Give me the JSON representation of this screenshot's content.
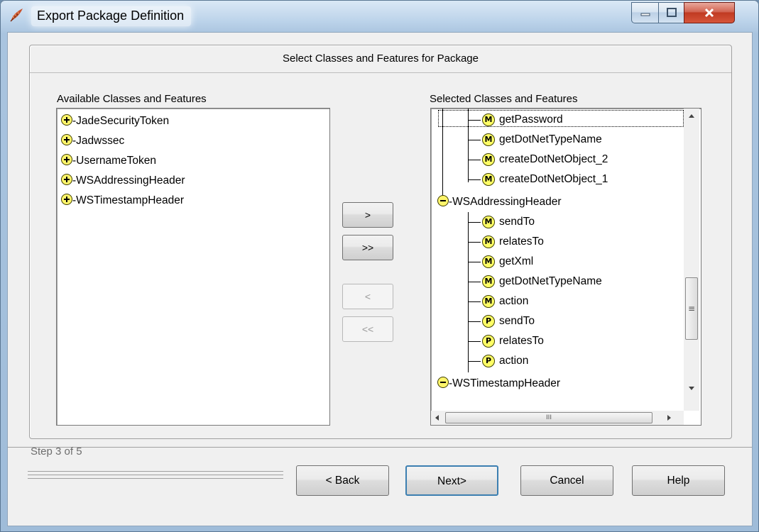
{
  "window": {
    "title": "Export Package Definition"
  },
  "group_header": "Select Classes and Features for Package",
  "available": {
    "label": "Available Classes and Features",
    "items": [
      "-JadeSecurityToken",
      "-Jadwssec",
      "-UsernameToken",
      "-WSAddressingHeader",
      "-WSTimestampHeader"
    ]
  },
  "selected": {
    "label": "Selected Classes and Features",
    "items": [
      {
        "badge": "M",
        "text": "getPassword"
      },
      {
        "badge": "M",
        "text": "getDotNetTypeName"
      },
      {
        "badge": "M",
        "text": "createDotNetObject_2"
      },
      {
        "badge": "M",
        "text": "createDotNetObject_1"
      },
      {
        "badge": "-",
        "text": "-WSAddressingHeader"
      },
      {
        "badge": "M",
        "text": "sendTo"
      },
      {
        "badge": "M",
        "text": "relatesTo"
      },
      {
        "badge": "M",
        "text": "getXml"
      },
      {
        "badge": "M",
        "text": "getDotNetTypeName"
      },
      {
        "badge": "M",
        "text": "action"
      },
      {
        "badge": "P",
        "text": "sendTo"
      },
      {
        "badge": "P",
        "text": "relatesTo"
      },
      {
        "badge": "P",
        "text": "action"
      },
      {
        "badge": "-",
        "text": "-WSTimestampHeader"
      }
    ]
  },
  "transfer_buttons": {
    "add": ">",
    "add_all": ">>",
    "remove": "<",
    "remove_all": "<<"
  },
  "footer": {
    "step": "Step 3 of 5",
    "back": "< Back",
    "next": "Next>",
    "cancel": "Cancel",
    "help": "Help"
  },
  "scrollbar": {
    "grip_glyph": "≡",
    "hscroll_glyph": "III"
  },
  "colors": {
    "badge_fill": "#ffff66",
    "titlebar": "#bcd3ea",
    "close_button": "#c03a22"
  }
}
